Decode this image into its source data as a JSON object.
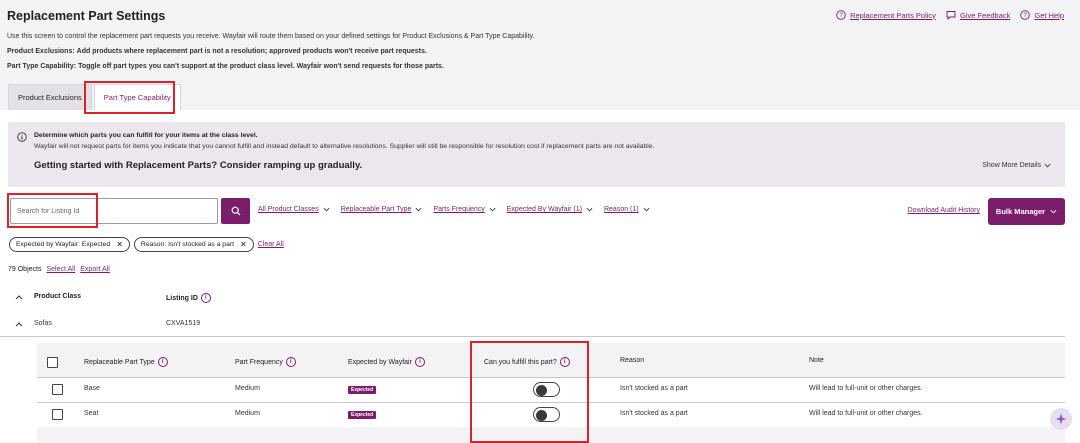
{
  "page": {
    "title": "Replacement Part Settings",
    "help_links": [
      {
        "label": "Replacement Parts Policy",
        "icon": "question-circle-icon"
      },
      {
        "label": "Give Feedback",
        "icon": "chat-icon"
      },
      {
        "label": "Get Help",
        "icon": "question-circle-icon"
      }
    ],
    "description": "Use this screen to control the replacement part requests you receive. Wayfair will route them based on your defined settings for Product Exclusions & Part Type Capability.",
    "exclusions_label": "Product Exclusions:",
    "exclusions_text": "Add products where replacement part is not a resolution; approved products won't receive part requests.",
    "capability_label": "Part Type Capability:",
    "capability_text": "Toggle off part types you can't support at the product class level. Wayfair won't send requests for those parts."
  },
  "tabs": [
    {
      "label": "Product Exclusions",
      "active": false
    },
    {
      "label": "Part Type Capability",
      "active": true
    }
  ],
  "info": {
    "line1": "Determine which parts you can fulfill for your items at the class level.",
    "line2": "Wayfair will not request parts for items you indicate that you cannot fulfill and instead default to alternative resolutions. Supplier will still be responsible for resolution cost if replacement parts are not available.",
    "headline": "Getting started with Replacement Parts? Consider ramping up gradually.",
    "show_more": "Show More Details"
  },
  "search": {
    "placeholder": "Search for Listing Id",
    "value": ""
  },
  "filters": [
    "All Product Classes",
    "Replaceable Part Type",
    "Parts Frequency",
    "Expected By Wayfair (1)",
    "Reason (1)"
  ],
  "download_audit": "Download Audit History",
  "bulk_manager": "Bulk Manager",
  "chips": [
    "Expected by Wayfair: Expected",
    "Reason: Isn't stocked as a part"
  ],
  "clear_all": "Clear All",
  "count": {
    "text": "79 Objects",
    "select_all": "Select All",
    "export_all": "Export All"
  },
  "table": {
    "headers": {
      "product_class": "Product Class",
      "listing_id": "Listing ID"
    },
    "row": {
      "product_class": "Sofas",
      "listing_id": "CXVA1519"
    }
  },
  "subtable": {
    "headers": {
      "part_type": "Replaceable Part Type",
      "frequency": "Part Frequency",
      "expected": "Expected by Wayfair",
      "fulfill": "Can you fulfill this part?",
      "reason": "Reason",
      "note": "Note"
    },
    "rows": [
      {
        "part_type": "Base",
        "frequency": "Medium",
        "expected": "Expected",
        "fulfill": false,
        "reason": "Isn't stocked as a part",
        "note": "Will lead to full-unit or other charges."
      },
      {
        "part_type": "Seat",
        "frequency": "Medium",
        "expected": "Expected",
        "fulfill": false,
        "reason": "Isn't stocked as a part",
        "note": "Will lead to full-unit or other charges."
      }
    ]
  },
  "colors": {
    "brand": "#7a1e6c",
    "highlight": "#d8232a",
    "panel": "#f3f2f4",
    "info_bg": "#ece7ee"
  }
}
